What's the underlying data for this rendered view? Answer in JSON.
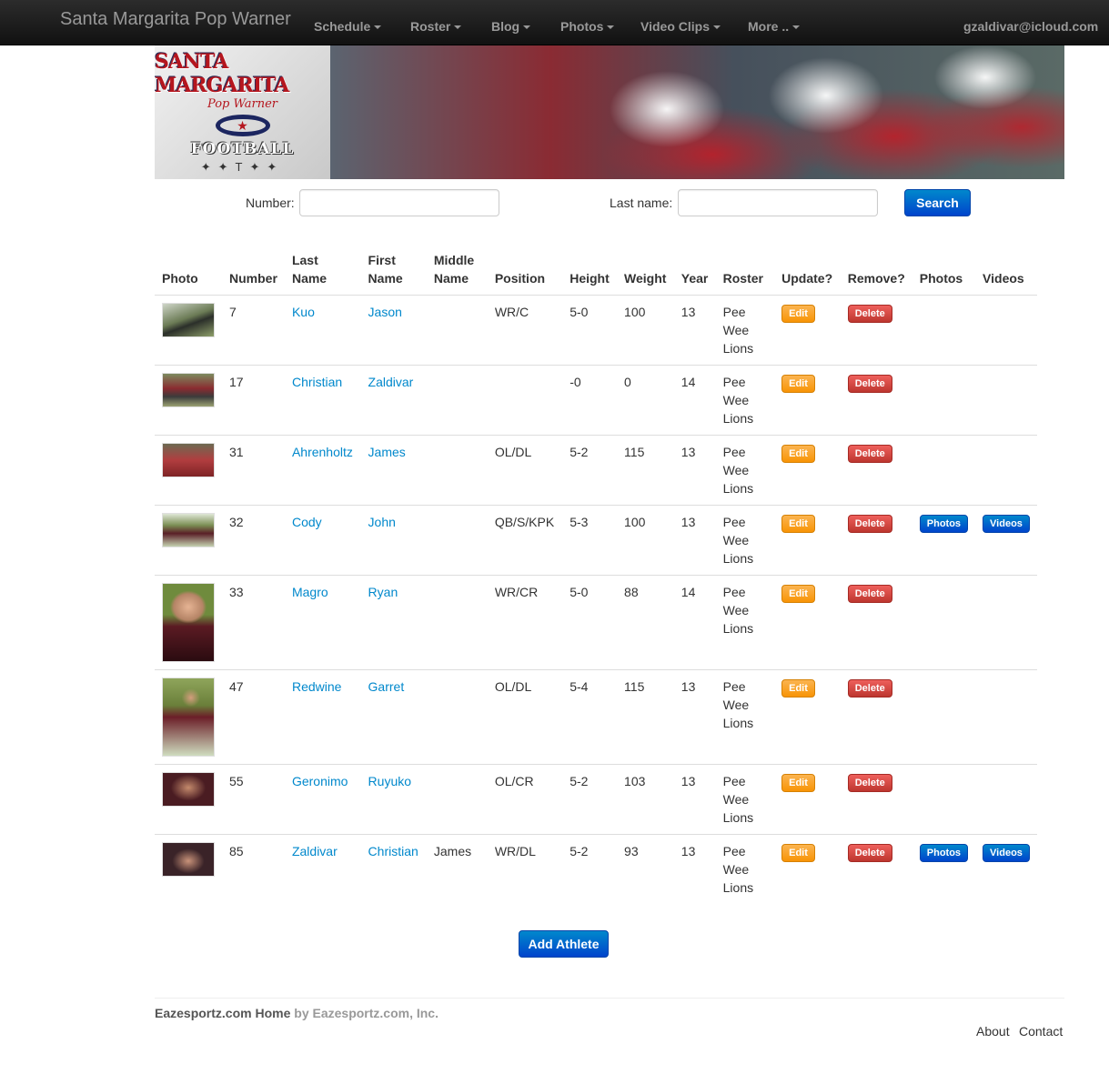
{
  "navbar": {
    "brand": "Santa Margarita Pop Warner",
    "menu": [
      {
        "label": "Schedule"
      },
      {
        "label": "Roster"
      },
      {
        "label": "Blog"
      },
      {
        "label": "Photos"
      },
      {
        "label": "Video Clips"
      },
      {
        "label": "More .."
      }
    ],
    "user": "gzaldivar@icloud.com"
  },
  "banner": {
    "logo_title": "SANTA MARGARITA",
    "logo_subtitle": "Pop Warner",
    "logo_football": "FOOTBALL"
  },
  "search": {
    "number_label": "Number:",
    "number_value": "",
    "lastname_label": "Last name:",
    "lastname_value": "",
    "button_label": "Search"
  },
  "table": {
    "headers": [
      "Photo",
      "Number",
      "Last Name",
      "First Name",
      "Middle Name",
      "Position",
      "Height",
      "Weight",
      "Year",
      "Roster",
      "Update?",
      "Remove?",
      "Photos",
      "Videos"
    ],
    "edit_label": "Edit",
    "delete_label": "Delete",
    "photos_label": "Photos",
    "videos_label": "Videos",
    "rows": [
      {
        "number": "7",
        "last": "Kuo",
        "first": "Jason",
        "middle": "",
        "position": "WR/C",
        "height": "5-0",
        "weight": "100",
        "year": "13",
        "roster": "Pee Wee Lions"
      },
      {
        "number": "17",
        "last": "Christian",
        "first": "Zaldivar",
        "middle": "",
        "position": "",
        "height": "-0",
        "weight": "0",
        "year": "14",
        "roster": "Pee Wee Lions"
      },
      {
        "number": "31",
        "last": "Ahrenholtz",
        "first": "James",
        "middle": "",
        "position": "OL/DL",
        "height": "5-2",
        "weight": "115",
        "year": "13",
        "roster": "Pee Wee Lions"
      },
      {
        "number": "32",
        "last": "Cody",
        "first": "John",
        "middle": "",
        "position": "QB/S/KPK",
        "height": "5-3",
        "weight": "100",
        "year": "13",
        "roster": "Pee Wee Lions"
      },
      {
        "number": "33",
        "last": "Magro",
        "first": "Ryan",
        "middle": "",
        "position": "WR/CR",
        "height": "5-0",
        "weight": "88",
        "year": "14",
        "roster": "Pee Wee Lions"
      },
      {
        "number": "47",
        "last": "Redwine",
        "first": "Garret",
        "middle": "",
        "position": "OL/DL",
        "height": "5-4",
        "weight": "115",
        "year": "13",
        "roster": "Pee Wee Lions"
      },
      {
        "number": "55",
        "last": "Geronimo",
        "first": "Ruyuko",
        "middle": "",
        "position": "OL/CR",
        "height": "5-2",
        "weight": "103",
        "year": "13",
        "roster": "Pee Wee Lions"
      },
      {
        "number": "85",
        "last": "Zaldivar",
        "first": "Christian",
        "middle": "James",
        "position": "WR/DL",
        "height": "5-2",
        "weight": "93",
        "year": "13",
        "roster": "Pee Wee Lions"
      }
    ]
  },
  "add_button": "Add Athlete",
  "footer": {
    "home_link": "Eazesportz.com Home",
    "byline": " by Eazesportz.com, Inc.",
    "about": "About",
    "contact": "Contact"
  }
}
